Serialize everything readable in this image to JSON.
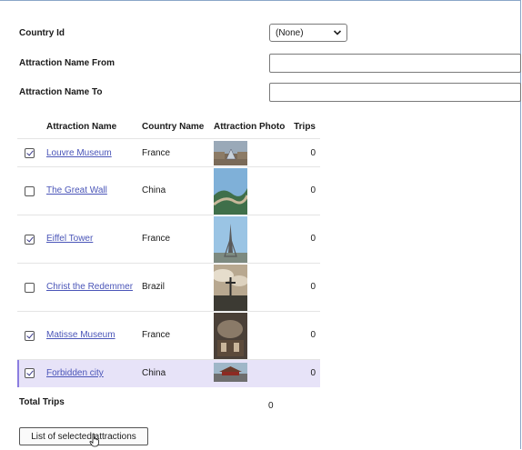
{
  "filters": {
    "country_id_label": "Country Id",
    "country_id_value": "(None)",
    "attraction_from_label": "Attraction Name From",
    "attraction_to_label": "Attraction Name To"
  },
  "table": {
    "headers": [
      "Attraction Name",
      "Country Name",
      "Attraction Photo",
      "Trips"
    ],
    "rows": [
      {
        "name": "Louvre Museum",
        "country": "France",
        "trips": "0",
        "checked": true
      },
      {
        "name": "The Great Wall",
        "country": "China",
        "trips": "0",
        "checked": false
      },
      {
        "name": "Eiffel Tower",
        "country": "France",
        "trips": "0",
        "checked": true
      },
      {
        "name": "Christ the Redemmer",
        "country": "Brazil",
        "trips": "0",
        "checked": false
      },
      {
        "name": "Matisse Museum",
        "country": "France",
        "trips": "0",
        "checked": true
      },
      {
        "name": "Forbidden city",
        "country": "China",
        "trips": "0",
        "checked": true
      }
    ]
  },
  "totals": {
    "label": "Total Trips",
    "value": "0"
  },
  "actions": {
    "list_button": "List of selected attractions"
  },
  "icons": {
    "dropdown": "chevron-down-icon",
    "checkbox": "checkbox-icon",
    "cursor": "hand-pointer-icon"
  },
  "colors": {
    "link": "#4a55b8",
    "selected_row": "#e7e3f8",
    "selected_accent": "#8b7de0",
    "frame": "#8aa6c8"
  }
}
